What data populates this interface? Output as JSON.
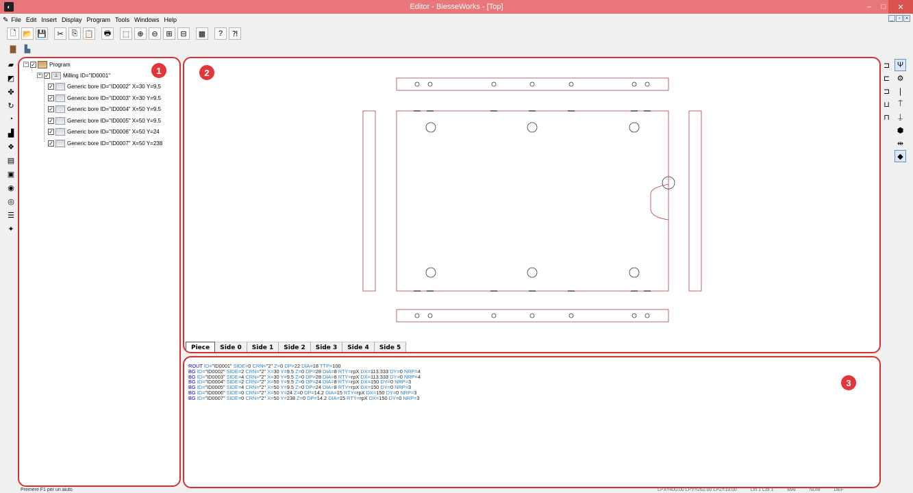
{
  "window": {
    "title": "Editor - BiesseWorks - [Top]"
  },
  "menu": [
    "File",
    "Edit",
    "Insert",
    "Display",
    "Program",
    "Tools",
    "Windows",
    "Help"
  ],
  "badges": [
    "1",
    "2",
    "3"
  ],
  "tree": {
    "root": "Program",
    "milling": "Milling ID=\"ID0001\"",
    "bores": [
      "Generic bore ID=\"ID0002\" X=30 Y=9.5",
      "Generic bore ID=\"ID0003\" X=30 Y=9.5",
      "Generic bore ID=\"ID0004\" X=50 Y=9.5",
      "Generic bore ID=\"ID0005\" X=50 Y=9.5",
      "Generic bore ID=\"ID0006\" X=50 Y=24",
      "Generic bore ID=\"ID0007\" X=50 Y=238"
    ]
  },
  "tabs": [
    "Piece",
    "Side 0",
    "Side 1",
    "Side 2",
    "Side 3",
    "Side 4",
    "Side 5"
  ],
  "code": [
    [
      [
        "k",
        "ROUT"
      ],
      [
        "p",
        " ID="
      ],
      [
        "v",
        "\"ID0001\""
      ],
      [
        "p",
        " SIDE="
      ],
      [
        "v",
        "0"
      ],
      [
        "p",
        " CRN="
      ],
      [
        "v",
        "\"2\""
      ],
      [
        "p",
        " Z="
      ],
      [
        "v",
        "0"
      ],
      [
        "p",
        " DP="
      ],
      [
        "v",
        "22"
      ],
      [
        "p",
        " DIA="
      ],
      [
        "v",
        "18"
      ],
      [
        "p",
        " TTP="
      ],
      [
        "v",
        "100"
      ]
    ],
    [
      [
        "k",
        "BG"
      ],
      [
        "p",
        " ID="
      ],
      [
        "v",
        "\"ID0002\""
      ],
      [
        "p",
        " SIDE="
      ],
      [
        "v",
        "2"
      ],
      [
        "p",
        " CRN="
      ],
      [
        "v",
        "\"2\""
      ],
      [
        "p",
        " X="
      ],
      [
        "v",
        "30"
      ],
      [
        "p",
        " Y="
      ],
      [
        "v",
        "9.5"
      ],
      [
        "p",
        " Z="
      ],
      [
        "v",
        "0"
      ],
      [
        "p",
        " DP="
      ],
      [
        "v",
        "28"
      ],
      [
        "p",
        " DIA="
      ],
      [
        "v",
        "8"
      ],
      [
        "p",
        " RTY="
      ],
      [
        "v",
        "rpX"
      ],
      [
        "p",
        " DX="
      ],
      [
        "v",
        "113.333"
      ],
      [
        "p",
        " DY="
      ],
      [
        "v",
        "0"
      ],
      [
        "p",
        " NRP="
      ],
      [
        "v",
        "4"
      ]
    ],
    [
      [
        "k",
        "BG"
      ],
      [
        "p",
        " ID="
      ],
      [
        "v",
        "\"ID0003\""
      ],
      [
        "p",
        " SIDE="
      ],
      [
        "v",
        "4"
      ],
      [
        "p",
        " CRN="
      ],
      [
        "v",
        "\"2\""
      ],
      [
        "p",
        " X="
      ],
      [
        "v",
        "30"
      ],
      [
        "p",
        " Y="
      ],
      [
        "v",
        "9.5"
      ],
      [
        "p",
        " Z="
      ],
      [
        "v",
        "0"
      ],
      [
        "p",
        " DP="
      ],
      [
        "v",
        "28"
      ],
      [
        "p",
        " DIA="
      ],
      [
        "v",
        "8"
      ],
      [
        "p",
        " RTY="
      ],
      [
        "v",
        "rpX"
      ],
      [
        "p",
        " DX="
      ],
      [
        "v",
        "113.333"
      ],
      [
        "p",
        " DY="
      ],
      [
        "v",
        "0"
      ],
      [
        "p",
        " NRP="
      ],
      [
        "v",
        "4"
      ]
    ],
    [
      [
        "k",
        "BG"
      ],
      [
        "p",
        " ID="
      ],
      [
        "v",
        "\"ID0004\""
      ],
      [
        "p",
        " SIDE="
      ],
      [
        "v",
        "2"
      ],
      [
        "p",
        " CRN="
      ],
      [
        "v",
        "\"2\""
      ],
      [
        "p",
        " X="
      ],
      [
        "v",
        "50"
      ],
      [
        "p",
        " Y="
      ],
      [
        "v",
        "9.5"
      ],
      [
        "p",
        " Z="
      ],
      [
        "v",
        "0"
      ],
      [
        "p",
        " DP="
      ],
      [
        "v",
        "24"
      ],
      [
        "p",
        " DIA="
      ],
      [
        "v",
        "8"
      ],
      [
        "p",
        " RTY="
      ],
      [
        "v",
        "rpX"
      ],
      [
        "p",
        " DX="
      ],
      [
        "v",
        "150"
      ],
      [
        "p",
        " DY="
      ],
      [
        "v",
        "0"
      ],
      [
        "p",
        " NRP="
      ],
      [
        "v",
        "3"
      ]
    ],
    [
      [
        "k",
        "BG"
      ],
      [
        "p",
        " ID="
      ],
      [
        "v",
        "\"ID0005\""
      ],
      [
        "p",
        " SIDE="
      ],
      [
        "v",
        "4"
      ],
      [
        "p",
        " CRN="
      ],
      [
        "v",
        "\"2\""
      ],
      [
        "p",
        " X="
      ],
      [
        "v",
        "50"
      ],
      [
        "p",
        " Y="
      ],
      [
        "v",
        "9.5"
      ],
      [
        "p",
        " Z="
      ],
      [
        "v",
        "0"
      ],
      [
        "p",
        " DP="
      ],
      [
        "v",
        "24"
      ],
      [
        "p",
        " DIA="
      ],
      [
        "v",
        "8"
      ],
      [
        "p",
        " RTY="
      ],
      [
        "v",
        "rpX"
      ],
      [
        "p",
        " DX="
      ],
      [
        "v",
        "150"
      ],
      [
        "p",
        " DY="
      ],
      [
        "v",
        "0"
      ],
      [
        "p",
        " NRP="
      ],
      [
        "v",
        "3"
      ]
    ],
    [
      [
        "k",
        "BG"
      ],
      [
        "p",
        " ID="
      ],
      [
        "v",
        "\"ID0006\""
      ],
      [
        "p",
        " SIDE="
      ],
      [
        "v",
        "0"
      ],
      [
        "p",
        " CRN="
      ],
      [
        "v",
        "\"2\""
      ],
      [
        "p",
        " X="
      ],
      [
        "v",
        "50"
      ],
      [
        "p",
        " Y="
      ],
      [
        "v",
        "24"
      ],
      [
        "p",
        " Z="
      ],
      [
        "v",
        "0"
      ],
      [
        "p",
        " DP="
      ],
      [
        "v",
        "14.2"
      ],
      [
        "p",
        " DIA="
      ],
      [
        "v",
        "15"
      ],
      [
        "p",
        " RTY="
      ],
      [
        "v",
        "rpX"
      ],
      [
        "p",
        " DX="
      ],
      [
        "v",
        "150"
      ],
      [
        "p",
        " DY="
      ],
      [
        "v",
        "0"
      ],
      [
        "p",
        " NRP="
      ],
      [
        "v",
        "3"
      ]
    ],
    [
      [
        "k",
        "BG"
      ],
      [
        "p",
        " ID="
      ],
      [
        "v",
        "\"ID0007\""
      ],
      [
        "p",
        " SIDE="
      ],
      [
        "v",
        "0"
      ],
      [
        "p",
        " CRN="
      ],
      [
        "v",
        "\"2\""
      ],
      [
        "p",
        " X="
      ],
      [
        "v",
        "50"
      ],
      [
        "p",
        " Y="
      ],
      [
        "v",
        "238"
      ],
      [
        "p",
        " Z="
      ],
      [
        "v",
        "0"
      ],
      [
        "p",
        " DP="
      ],
      [
        "v",
        "14.2"
      ],
      [
        "p",
        " DIA="
      ],
      [
        "v",
        "15"
      ],
      [
        "p",
        " RTY="
      ],
      [
        "v",
        "rpX"
      ],
      [
        "p",
        " DX="
      ],
      [
        "v",
        "150"
      ],
      [
        "p",
        " DY="
      ],
      [
        "v",
        "0"
      ],
      [
        "p",
        " NRP="
      ],
      [
        "v",
        "3"
      ]
    ]
  ],
  "status": {
    "help": "Premere F1 per un aiuto",
    "coords": "LPX=400.00 LPY=262.00 LPZ=19.00",
    "cursor": "Lin 1 Col 1",
    "indicators": [
      "MAI",
      "NUM",
      "DEF"
    ]
  },
  "colors": {
    "accent_red": "#d83030",
    "titlebar": "#e9767a",
    "drawing": "#b43c3c",
    "keyword": "#0000c8",
    "param": "#2a84c6"
  }
}
